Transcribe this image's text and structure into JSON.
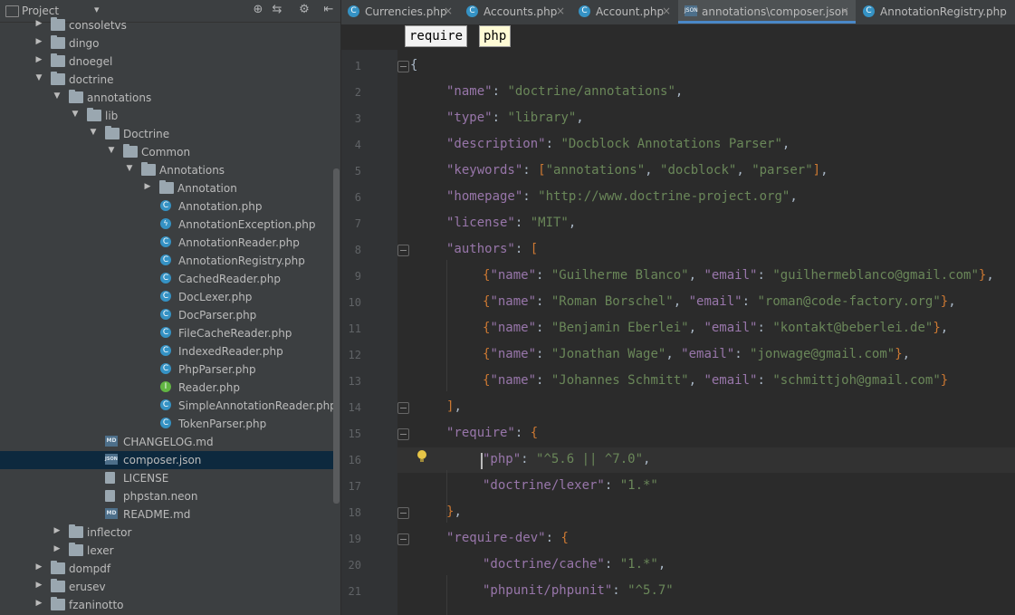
{
  "project_panel": {
    "title": "Project",
    "dropdown": "▾",
    "buttons": [
      "⊕",
      "⇆",
      "⚙",
      "⇤"
    ],
    "tree": [
      {
        "label": "consoletvs",
        "icon": "folder-icon",
        "arrow": "▶",
        "depth": 0
      },
      {
        "label": "dingo",
        "icon": "folder-icon",
        "arrow": "▶",
        "depth": 0
      },
      {
        "label": "dnoegel",
        "icon": "folder-icon",
        "arrow": "▶",
        "depth": 0
      },
      {
        "label": "doctrine",
        "icon": "folder-icon",
        "arrow": "▼",
        "depth": 0
      },
      {
        "label": "annotations",
        "icon": "folder-icon",
        "arrow": "▼",
        "depth": 1
      },
      {
        "label": "lib",
        "icon": "folder-icon",
        "arrow": "▼",
        "depth": 2
      },
      {
        "label": "Doctrine",
        "icon": "folder-icon",
        "arrow": "▼",
        "depth": 3
      },
      {
        "label": "Common",
        "icon": "folder-icon",
        "arrow": "▼",
        "depth": 4
      },
      {
        "label": "Annotations",
        "icon": "folder-icon",
        "arrow": "▼",
        "depth": 5
      },
      {
        "label": "Annotation",
        "icon": "folder-icon",
        "arrow": "▶",
        "depth": 6
      },
      {
        "label": "Annotation.php",
        "icon": "php-class-icon",
        "depth": 7
      },
      {
        "label": "AnnotationException.php",
        "icon": "php-exception-icon",
        "depth": 7
      },
      {
        "label": "AnnotationReader.php",
        "icon": "php-class-icon",
        "depth": 7
      },
      {
        "label": "AnnotationRegistry.php",
        "icon": "php-class-icon",
        "depth": 7
      },
      {
        "label": "CachedReader.php",
        "icon": "php-class-icon",
        "depth": 7
      },
      {
        "label": "DocLexer.php",
        "icon": "php-class-icon",
        "depth": 7
      },
      {
        "label": "DocParser.php",
        "icon": "php-class-icon",
        "depth": 7
      },
      {
        "label": "FileCacheReader.php",
        "icon": "php-class-icon",
        "depth": 7
      },
      {
        "label": "IndexedReader.php",
        "icon": "php-class-icon",
        "depth": 7
      },
      {
        "label": "PhpParser.php",
        "icon": "php-class-icon",
        "depth": 7
      },
      {
        "label": "Reader.php",
        "icon": "php-interface-icon",
        "depth": 7
      },
      {
        "label": "SimpleAnnotationReader.php",
        "icon": "php-class-icon",
        "depth": 7
      },
      {
        "label": "TokenParser.php",
        "icon": "php-class-icon",
        "depth": 7
      },
      {
        "label": "CHANGELOG.md",
        "icon": "markdown-file-icon",
        "depth": 3
      },
      {
        "label": "composer.json",
        "icon": "json-file-icon",
        "depth": 3,
        "selected": true
      },
      {
        "label": "LICENSE",
        "icon": "text-file-icon",
        "depth": 3
      },
      {
        "label": "phpstan.neon",
        "icon": "text-file-icon",
        "depth": 3
      },
      {
        "label": "README.md",
        "icon": "markdown-file-icon",
        "depth": 3
      },
      {
        "label": "inflector",
        "icon": "folder-icon",
        "arrow": "▶",
        "depth": 1
      },
      {
        "label": "lexer",
        "icon": "folder-icon",
        "arrow": "▶",
        "depth": 1
      },
      {
        "label": "dompdf",
        "icon": "folder-icon",
        "arrow": "▶",
        "depth": 0
      },
      {
        "label": "erusev",
        "icon": "folder-icon",
        "arrow": "▶",
        "depth": 0
      },
      {
        "label": "fzaninotto",
        "icon": "folder-icon",
        "arrow": "▶",
        "depth": 0
      }
    ]
  },
  "tabs": [
    {
      "label": "Currencies.php",
      "icon": "php-class-icon",
      "active": false
    },
    {
      "label": "Accounts.php",
      "icon": "php-class-icon",
      "active": false
    },
    {
      "label": "Account.php",
      "icon": "php-class-icon",
      "active": false
    },
    {
      "label": "annotations\\composer.json",
      "icon": "json-file-icon",
      "active": true
    },
    {
      "label": "AnnotationRegistry.php",
      "icon": "php-class-icon",
      "active": false
    }
  ],
  "breadcrumb": [
    "require",
    "php"
  ],
  "editor": {
    "lines": [
      {
        "n": "1",
        "tokens": [
          [
            "b",
            "{"
          ]
        ]
      },
      {
        "n": "2",
        "tokens": [
          [
            "k",
            "\"name\""
          ],
          [
            "b",
            ": "
          ],
          [
            "s",
            "\"doctrine/annotations\""
          ],
          [
            "b",
            ","
          ]
        ]
      },
      {
        "n": "3",
        "tokens": [
          [
            "k",
            "\"type\""
          ],
          [
            "b",
            ": "
          ],
          [
            "s",
            "\"library\""
          ],
          [
            "b",
            ","
          ]
        ]
      },
      {
        "n": "4",
        "tokens": [
          [
            "k",
            "\"description\""
          ],
          [
            "b",
            ": "
          ],
          [
            "s",
            "\"Docblock Annotations Parser\""
          ],
          [
            "b",
            ","
          ]
        ]
      },
      {
        "n": "5",
        "tokens": [
          [
            "k",
            "\"keywords\""
          ],
          [
            "b",
            ": "
          ],
          [
            "p",
            "["
          ],
          [
            "s",
            "\"annotations\""
          ],
          [
            "b",
            ", "
          ],
          [
            "s",
            "\"docblock\""
          ],
          [
            "b",
            ", "
          ],
          [
            "s",
            "\"parser\""
          ],
          [
            "p",
            "]"
          ],
          [
            "b",
            ","
          ]
        ]
      },
      {
        "n": "6",
        "tokens": [
          [
            "k",
            "\"homepage\""
          ],
          [
            "b",
            ": "
          ],
          [
            "s",
            "\"http://www.doctrine-project.org\""
          ],
          [
            "b",
            ","
          ]
        ]
      },
      {
        "n": "7",
        "tokens": [
          [
            "k",
            "\"license\""
          ],
          [
            "b",
            ": "
          ],
          [
            "s",
            "\"MIT\""
          ],
          [
            "b",
            ","
          ]
        ]
      },
      {
        "n": "8",
        "tokens": [
          [
            "k",
            "\"authors\""
          ],
          [
            "b",
            ": "
          ],
          [
            "p",
            "["
          ]
        ]
      },
      {
        "n": "9",
        "tokens": [
          [
            "p",
            "{"
          ],
          [
            "k",
            "\"name\""
          ],
          [
            "b",
            ": "
          ],
          [
            "s",
            "\"Guilherme Blanco\""
          ],
          [
            "b",
            ", "
          ],
          [
            "k",
            "\"email\""
          ],
          [
            "b",
            ": "
          ],
          [
            "s",
            "\"guilhermeblanco@gmail.com\""
          ],
          [
            "p",
            "}"
          ],
          [
            "b",
            ","
          ]
        ]
      },
      {
        "n": "10",
        "tokens": [
          [
            "p",
            "{"
          ],
          [
            "k",
            "\"name\""
          ],
          [
            "b",
            ": "
          ],
          [
            "s",
            "\"Roman Borschel\""
          ],
          [
            "b",
            ", "
          ],
          [
            "k",
            "\"email\""
          ],
          [
            "b",
            ": "
          ],
          [
            "s",
            "\"roman@code-factory.org\""
          ],
          [
            "p",
            "}"
          ],
          [
            "b",
            ","
          ]
        ]
      },
      {
        "n": "11",
        "tokens": [
          [
            "p",
            "{"
          ],
          [
            "k",
            "\"name\""
          ],
          [
            "b",
            ": "
          ],
          [
            "s",
            "\"Benjamin Eberlei\""
          ],
          [
            "b",
            ", "
          ],
          [
            "k",
            "\"email\""
          ],
          [
            "b",
            ": "
          ],
          [
            "s",
            "\"kontakt@beberlei.de\""
          ],
          [
            "p",
            "}"
          ],
          [
            "b",
            ","
          ]
        ]
      },
      {
        "n": "12",
        "tokens": [
          [
            "p",
            "{"
          ],
          [
            "k",
            "\"name\""
          ],
          [
            "b",
            ": "
          ],
          [
            "s",
            "\"Jonathan Wage\""
          ],
          [
            "b",
            ", "
          ],
          [
            "k",
            "\"email\""
          ],
          [
            "b",
            ": "
          ],
          [
            "s",
            "\"jonwage@gmail.com\""
          ],
          [
            "p",
            "}"
          ],
          [
            "b",
            ","
          ]
        ]
      },
      {
        "n": "13",
        "tokens": [
          [
            "p",
            "{"
          ],
          [
            "k",
            "\"name\""
          ],
          [
            "b",
            ": "
          ],
          [
            "s",
            "\"Johannes Schmitt\""
          ],
          [
            "b",
            ", "
          ],
          [
            "k",
            "\"email\""
          ],
          [
            "b",
            ": "
          ],
          [
            "s",
            "\"schmittjoh@gmail.com\""
          ],
          [
            "p",
            "}"
          ]
        ]
      },
      {
        "n": "14",
        "tokens": [
          [
            "p",
            "]"
          ],
          [
            "b",
            ","
          ]
        ]
      },
      {
        "n": "15",
        "tokens": [
          [
            "k",
            "\"require\""
          ],
          [
            "b",
            ": "
          ],
          [
            "p",
            "{"
          ]
        ]
      },
      {
        "n": "16",
        "tokens": [
          [
            "k",
            "\"php\""
          ],
          [
            "b",
            ": "
          ],
          [
            "s",
            "\"^5.6 || ^7.0\""
          ],
          [
            "b",
            ","
          ]
        ]
      },
      {
        "n": "17",
        "tokens": [
          [
            "k",
            "\"doctrine/lexer\""
          ],
          [
            "b",
            ": "
          ],
          [
            "s",
            "\"1.*\""
          ]
        ]
      },
      {
        "n": "18",
        "tokens": [
          [
            "p",
            "}"
          ],
          [
            "b",
            ","
          ]
        ]
      },
      {
        "n": "19",
        "tokens": [
          [
            "k",
            "\"require-dev\""
          ],
          [
            "b",
            ": "
          ],
          [
            "p",
            "{"
          ]
        ]
      },
      {
        "n": "20",
        "tokens": [
          [
            "k",
            "\"doctrine/cache\""
          ],
          [
            "b",
            ": "
          ],
          [
            "s",
            "\"1.*\""
          ],
          [
            "b",
            ","
          ]
        ]
      },
      {
        "n": "21",
        "tokens": [
          [
            "k",
            "\"phpunit/phpunit\""
          ],
          [
            "b",
            ": "
          ],
          [
            "s",
            "\"^5.7\""
          ]
        ]
      }
    ]
  },
  "colors": {
    "key": "#9876aa",
    "string": "#6a8759",
    "bracket": "#cc7832",
    "text": "#a9b7c6",
    "selection": "#0d293e",
    "tab_accent": "#4a88c7"
  }
}
